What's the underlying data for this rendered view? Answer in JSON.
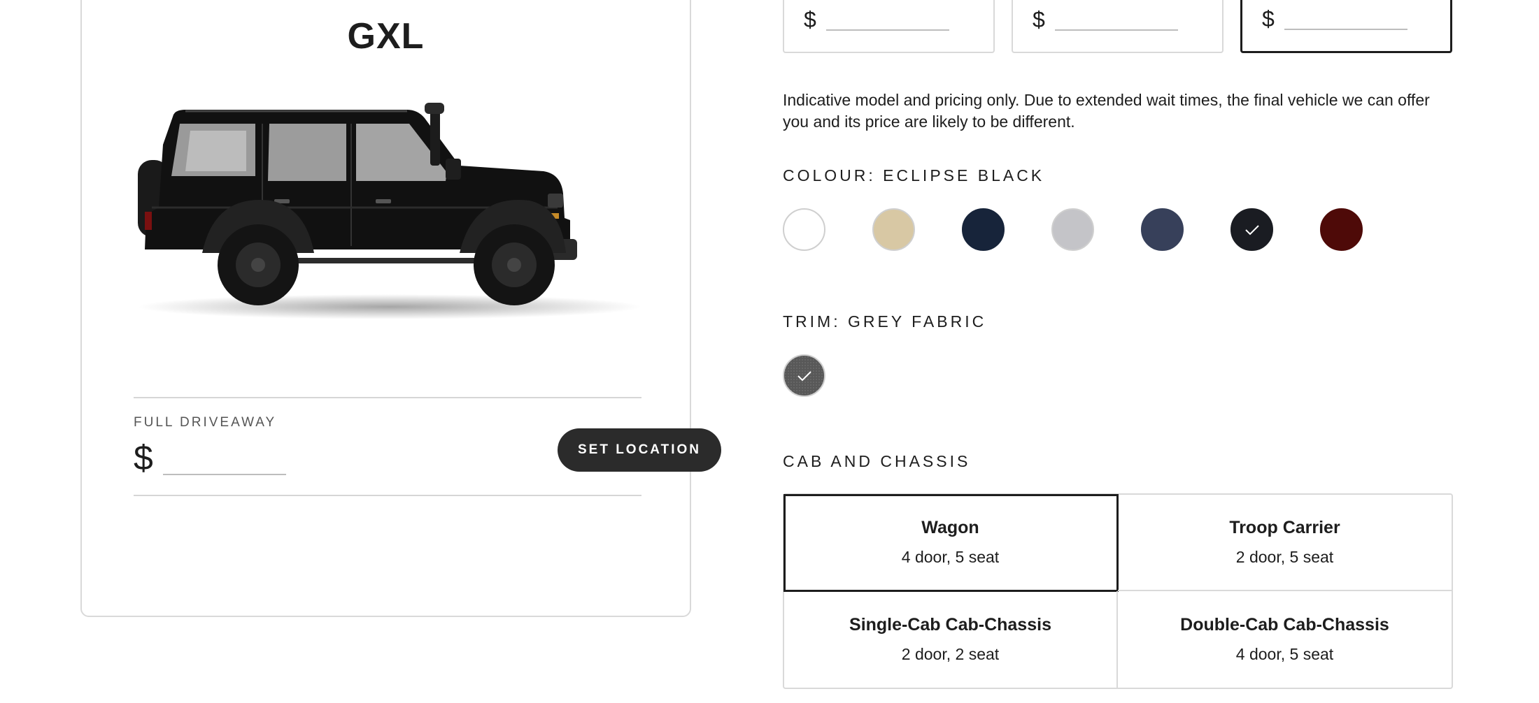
{
  "model": {
    "name": "GXL"
  },
  "driveaway": {
    "label": "FULL DRIVEAWAY",
    "currency": "$",
    "value": ""
  },
  "set_location_label": "SET LOCATION",
  "price_options": [
    {
      "currency": "$",
      "value": ""
    },
    {
      "currency": "$",
      "value": ""
    },
    {
      "currency": "$",
      "value": "",
      "selected": true
    }
  ],
  "disclaimer": "Indicative model and pricing only. Due to extended wait times, the final vehicle we can offer you and its price are likely to be different.",
  "colour": {
    "label": "COLOUR: ECLIPSE BLACK",
    "selected": "Eclipse Black",
    "swatches": [
      {
        "color": "#ffffff"
      },
      {
        "color": "#d8c8a4"
      },
      {
        "color": "#17243a"
      },
      {
        "color": "#c4c4c8"
      },
      {
        "color": "#37405a"
      },
      {
        "color": "#1a1c22",
        "selected": true
      },
      {
        "color": "#4e0a08"
      }
    ]
  },
  "trim": {
    "label": "TRIM: GREY FABRIC",
    "selected": "Grey Fabric"
  },
  "cab_chassis": {
    "label": "CAB AND CHASSIS",
    "options": [
      {
        "title": "Wagon",
        "sub": "4 door, 5 seat",
        "selected": true
      },
      {
        "title": "Troop Carrier",
        "sub": "2 door, 5 seat"
      },
      {
        "title": "Single-Cab Cab-Chassis",
        "sub": "2 door, 2 seat"
      },
      {
        "title": "Double-Cab Cab-Chassis",
        "sub": "4 door, 5 seat"
      }
    ]
  },
  "icons": {
    "check": "check-icon",
    "vehicle": "vehicle-image"
  }
}
